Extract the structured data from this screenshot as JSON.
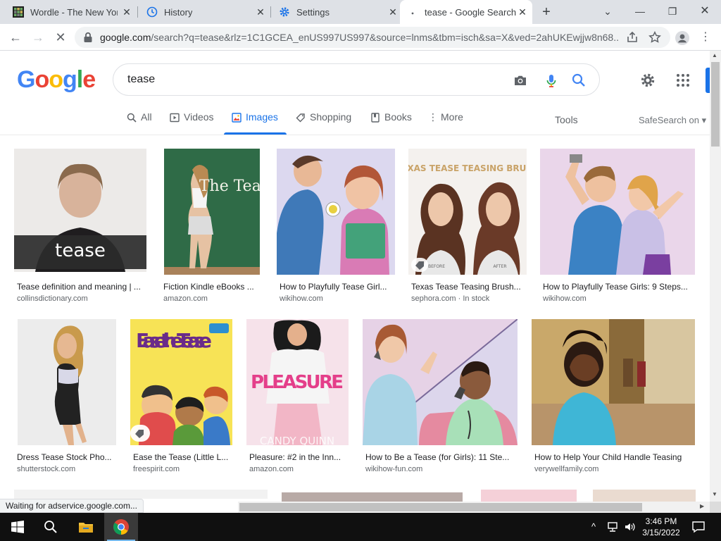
{
  "browser": {
    "tabs": [
      {
        "title": "Wordle - The New York Times",
        "favicon": "nyt-wordle-icon"
      },
      {
        "title": "History",
        "favicon": "history-icon"
      },
      {
        "title": "Settings",
        "favicon": "gear-icon"
      },
      {
        "title": "tease - Google Search",
        "favicon": "loading-dot",
        "active": true
      }
    ],
    "new_tab_label": "+",
    "url_main": "google.com",
    "url_rest": "/search?q=tease&rlz=1C1GCEA_enUS997US997&source=lnms&tbm=isch&sa=X&ved=2ahUKEwjjw8n68...",
    "status_text": "Waiting for adservice.google.com..."
  },
  "google": {
    "logo": "Google",
    "query": "tease",
    "nav": [
      {
        "label": "All"
      },
      {
        "label": "Videos"
      },
      {
        "label": "Images",
        "active": true
      },
      {
        "label": "Shopping"
      },
      {
        "label": "Books"
      },
      {
        "label": "More"
      }
    ],
    "tools_label": "Tools",
    "safesearch_label": "SafeSearch on"
  },
  "results": [
    {
      "caption": "Tease definition and meaning | ...",
      "source": "collinsdictionary.com",
      "overlay": "tease"
    },
    {
      "caption": "Fiction Kindle eBooks ...",
      "source": "amazon.com",
      "overlay": "The Tease"
    },
    {
      "caption": "How to Playfully Tease Girl...",
      "source": "wikihow.com"
    },
    {
      "caption": "Texas Tease Teasing Brush...",
      "source": "sephora.com",
      "extra": " · In stock",
      "overlay": "TEXAS TEASE TEASING BRUSH",
      "before": "BEFORE",
      "after": "AFTER"
    },
    {
      "caption": "How to Playfully Tease Girls: 9 Steps...",
      "source": "wikihow.com"
    },
    {
      "caption": "Dress Tease Stock Pho...",
      "source": "shutterstock.com"
    },
    {
      "caption": "Ease the Tease (Little L...",
      "source": "freespirit.com",
      "overlay": "Ease the Tease"
    },
    {
      "caption": "Pleasure: #2 in the Inn...",
      "source": "amazon.com",
      "overlay": "PLEASURE",
      "author": "CANDY QUINN"
    },
    {
      "caption": "How to Be a Tease (for Girls): 11 Ste...",
      "source": "wikihow-fun.com"
    },
    {
      "caption": "How to Help Your Child Handle Teasing",
      "source": "verywellfamily.com"
    }
  ],
  "taskbar": {
    "time": "3:46 PM",
    "date": "3/15/2022"
  },
  "colors": {
    "google_blue": "#4285f4",
    "google_red": "#ea4335",
    "google_yellow": "#fbbc05",
    "google_green": "#34a853",
    "link_blue": "#1a73e8"
  }
}
